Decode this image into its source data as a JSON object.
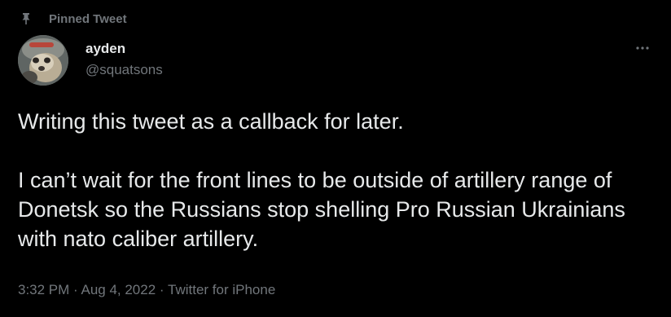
{
  "pinned": {
    "icon": "pin-icon",
    "label": "Pinned Tweet"
  },
  "author": {
    "avatar": "avatar",
    "display_name": "ayden",
    "handle": "@squatsons"
  },
  "more": {
    "icon": "more-horizontal-icon"
  },
  "tweet": {
    "line1": "Writing this tweet as a callback for later.",
    "paragraph2": "I can’t wait for the front lines to be outside of artillery range of Donetsk so the Russians stop shelling Pro Russian Ukrainians with nato caliber artillery."
  },
  "meta": {
    "time": "3:32 PM",
    "sep1": " · ",
    "date": "Aug 4, 2022",
    "sep2": " · ",
    "source": "Twitter for iPhone"
  },
  "colors": {
    "background": "#000000",
    "text_primary": "#e7e9ea",
    "text_secondary": "#71767b"
  }
}
